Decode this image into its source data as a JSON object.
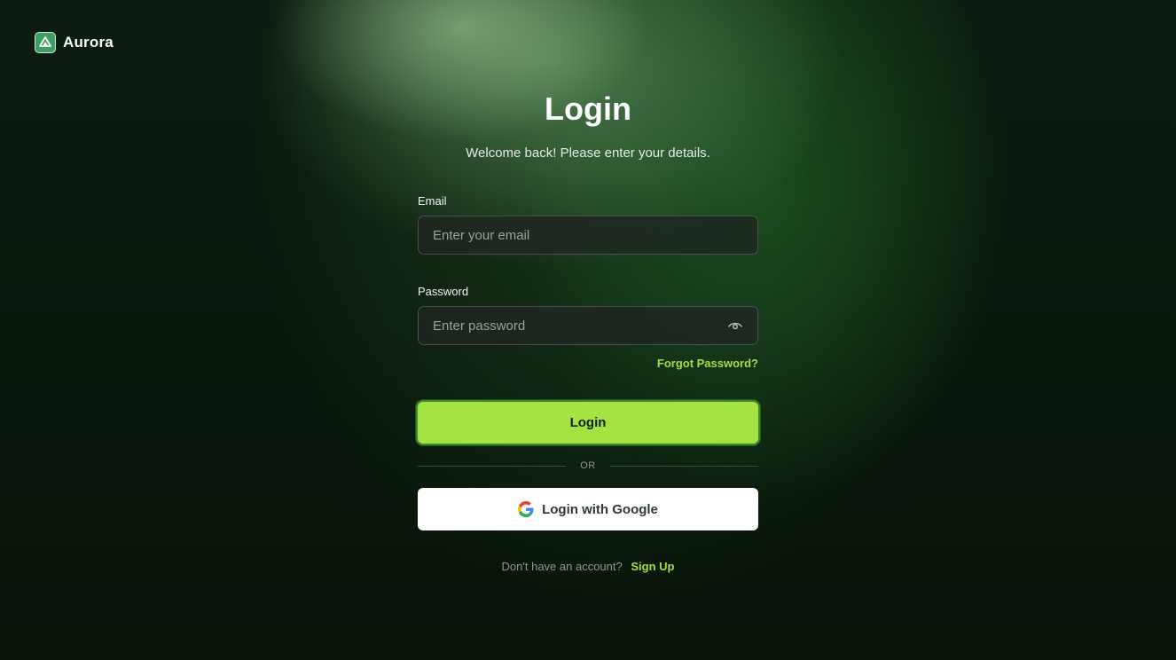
{
  "brand": {
    "name": "Aurora",
    "logo_icon": "mountain-logo-icon",
    "logo_color": "#3d9f64"
  },
  "login": {
    "title": "Login",
    "subtitle": "Welcome back! Please enter your details.",
    "email": {
      "label": "Email",
      "placeholder": "Enter your email",
      "value": ""
    },
    "password": {
      "label": "Password",
      "placeholder": "Enter password",
      "value": "",
      "toggle_icon": "eye-icon"
    },
    "forgot_label": "Forgot Password?",
    "submit_label": "Login",
    "divider_label": "OR",
    "google_label": "Login with Google",
    "google_icon": "google-icon",
    "signup_prompt": "Don't have an account?",
    "signup_label": "Sign Up"
  },
  "colors": {
    "accent": "#a4e341",
    "link": "#a7dd45",
    "background": "#0a160d"
  }
}
